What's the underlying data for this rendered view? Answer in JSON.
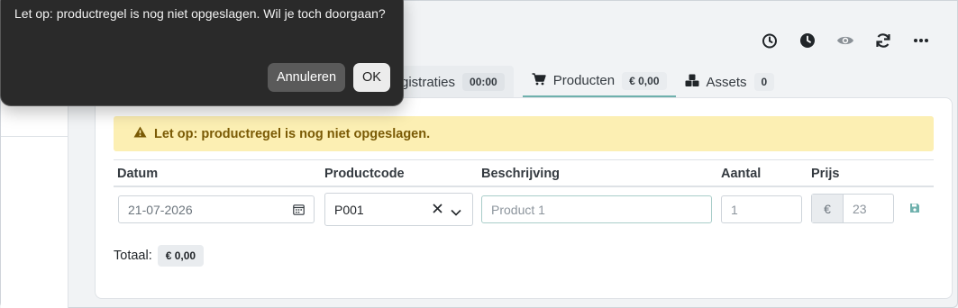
{
  "dialog": {
    "message": "Let op: productregel is nog niet opgeslagen. Wil je toch doorgaan?",
    "cancel_label": "Annuleren",
    "ok_label": "OK"
  },
  "toolbar": {
    "icons": [
      "timer-icon",
      "clock-icon",
      "eye-icon",
      "refresh-icon",
      "more-icon"
    ]
  },
  "tabs": [
    {
      "label": "gistraties",
      "badge": "00:00"
    },
    {
      "label": "Producten",
      "badge": "€ 0,00",
      "active": true,
      "icon": "cart-icon"
    },
    {
      "label": "Assets",
      "badge": "0",
      "icon": "cubes-icon"
    }
  ],
  "warning": {
    "text": "Let op: productregel is nog niet opgeslagen."
  },
  "table": {
    "headers": [
      "Datum",
      "Productcode",
      "Beschrijving",
      "Aantal",
      "Prijs"
    ],
    "row": {
      "date": "21-07-2026",
      "code": "P001",
      "description_placeholder": "Product 1",
      "quantity_placeholder": "1",
      "currency": "€",
      "price_placeholder": "23"
    }
  },
  "total": {
    "label": "Totaal:",
    "value": "€ 0,00"
  },
  "colors": {
    "accent": "#6fb1ad",
    "warning_bg": "#fcefb3",
    "warning_text": "#7a5a05",
    "dialog_bg": "#2a2a2a"
  }
}
